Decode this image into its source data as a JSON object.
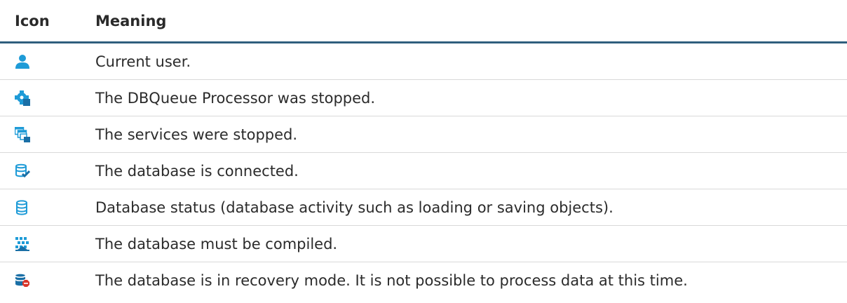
{
  "header": {
    "icon_col": "Icon",
    "meaning_col": "Meaning"
  },
  "colors": {
    "header_rule": "#2f5f7e",
    "icon_blue": "#1e9bd7",
    "icon_dark_blue": "#1a6fa6",
    "row_divider": "#d9d9d9",
    "stop_red": "#d9362b"
  },
  "rows": [
    {
      "icon": "current-user-icon",
      "meaning": "Current user."
    },
    {
      "icon": "dbqueue-processor-stopped-icon",
      "meaning": "The DBQueue Processor was stopped."
    },
    {
      "icon": "services-stopped-icon",
      "meaning": "The services were stopped."
    },
    {
      "icon": "database-connected-icon",
      "meaning": "The database is connected."
    },
    {
      "icon": "database-status-icon",
      "meaning": "Database status (database activity such as loading or saving objects)."
    },
    {
      "icon": "database-compile-icon",
      "meaning": "The database must be compiled."
    },
    {
      "icon": "database-recovery-mode-icon",
      "meaning": "The database is in recovery mode. It is not possible to process data at this time."
    }
  ]
}
